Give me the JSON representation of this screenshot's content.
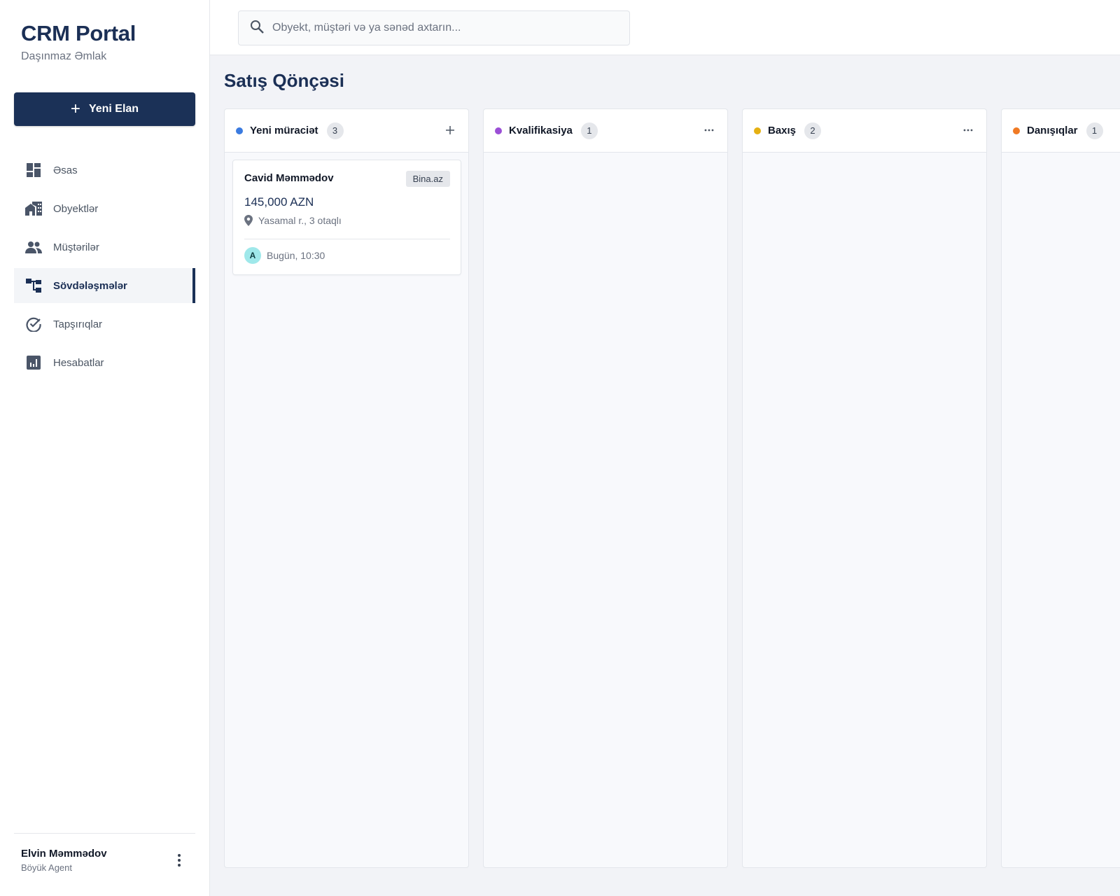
{
  "brand": {
    "title": "CRM Portal",
    "subtitle": "Daşınmaz Əmlak"
  },
  "actions": {
    "new_listing": "Yeni Elan"
  },
  "nav": {
    "items": [
      {
        "label": "Əsas",
        "icon": "dashboard-icon",
        "active": false
      },
      {
        "label": "Obyektlər",
        "icon": "buildings-icon",
        "active": false
      },
      {
        "label": "Müştərilər",
        "icon": "people-icon",
        "active": false
      },
      {
        "label": "Sövdələşmələr",
        "icon": "pipeline-icon",
        "active": true
      },
      {
        "label": "Tapşırıqlar",
        "icon": "check-circle-icon",
        "active": false
      },
      {
        "label": "Hesabatlar",
        "icon": "chart-icon",
        "active": false
      }
    ]
  },
  "user": {
    "name": "Elvin Məmmədov",
    "role": "Böyük Agent"
  },
  "search": {
    "placeholder": "Obyekt, müştəri və ya sənəd axtarın..."
  },
  "page": {
    "title": "Satış Qönçəsi"
  },
  "columns": [
    {
      "title": "Yeni müraciət",
      "count": "3",
      "color": "#3b7be0",
      "action": "add-icon"
    },
    {
      "title": "Kvalifikasiya",
      "count": "1",
      "color": "#9b4fd6",
      "action": "more-icon"
    },
    {
      "title": "Baxış",
      "count": "2",
      "color": "#e5b012",
      "action": "more-icon"
    },
    {
      "title": "Danışıqlar",
      "count": "1",
      "color": "#f07a24",
      "action": "more-icon"
    }
  ],
  "card": {
    "name": "Cavid Məmmədov",
    "source": "Bina.az",
    "price": "145,000 AZN",
    "location": "Yasamal r., 3 otaqlı",
    "avatar": "A",
    "time": "Bugün, 10:30"
  },
  "colors": {
    "primary": "#1b3157",
    "background": "#f2f3f7"
  }
}
